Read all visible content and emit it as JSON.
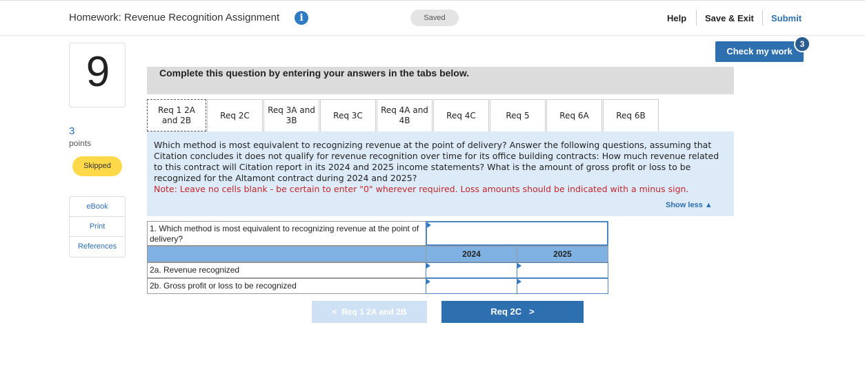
{
  "header": {
    "title": "Homework: Revenue Recognition Assignment",
    "info_icon": "info-icon",
    "saved_label": "Saved",
    "help_label": "Help",
    "save_exit_label": "Save & Exit",
    "submit_label": "Submit"
  },
  "question": {
    "number": "9",
    "points": "3",
    "points_label": "points",
    "status": "Skipped"
  },
  "sidebar": {
    "links": [
      "eBook",
      "Print",
      "References"
    ]
  },
  "check_work": {
    "label": "Check my work",
    "badge": "3"
  },
  "instructions": "Complete this question by entering your answers in the tabs below.",
  "tabs": [
    {
      "label": "Req 1 2A and 2B",
      "active": true
    },
    {
      "label": "Req 2C"
    },
    {
      "label": "Req 3A and 3B"
    },
    {
      "label": "Req 3C"
    },
    {
      "label": "Req 4A and 4B"
    },
    {
      "label": "Req 4C"
    },
    {
      "label": "Req 5"
    },
    {
      "label": "Req 6A"
    },
    {
      "label": "Req 6B"
    }
  ],
  "prompt": {
    "text": "Which method is most equivalent to recognizing revenue at the point of delivery? Answer the following questions, assuming that Citation concludes it does not qualify for revenue recognition over time for its office building contracts: How much revenue related to this contract will Citation report in its 2024 and 2025 income statements? What is the amount of gross profit or loss to be recognized for the Altamont contract during 2024 and 2025?",
    "note": "Note: Leave no cells blank - be certain to enter \"0\" wherever required. Loss amounts should be indicated with a minus sign.",
    "show_less": "Show less"
  },
  "table": {
    "q1_label": "1. Which method is most equivalent to recognizing revenue at the point of delivery?",
    "q1_value": "",
    "col_headers": [
      "2024",
      "2025"
    ],
    "rows": [
      {
        "label": "2a. Revenue recognized",
        "values": [
          "",
          ""
        ]
      },
      {
        "label": "2b. Gross profit or loss to be recognized",
        "values": [
          "",
          ""
        ]
      }
    ]
  },
  "nav": {
    "prev_label": "Req 1 2A and 2B",
    "next_label": "Req 2C"
  },
  "colors": {
    "accent": "#2e6fb0",
    "skipped": "#ffd94a",
    "panel": "#dcebf7",
    "note": "#c0272d"
  }
}
